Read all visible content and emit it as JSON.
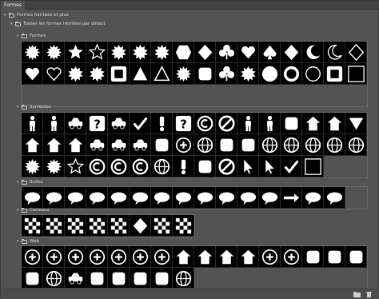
{
  "panel": {
    "tab_label": "Formes"
  },
  "tree": {
    "root_label": "Formes héritées et plus",
    "default_label": "Toutes les formes héritées par défaut",
    "groups": [
      {
        "label": "Formes",
        "icons": [
          "star-burst",
          "sun-burst",
          "star5",
          "star5-outline",
          "gear-seal",
          "seal",
          "badge-seal",
          "hexagon",
          "diamond-frame",
          "clover",
          "heart",
          "spade",
          "diamond",
          "crescent",
          "crescent-outline",
          "diamond-outline",
          "heart-solid",
          "heart-outline",
          "flower-seal",
          "square-seal",
          "square-frame",
          "triangle",
          "triangle-outline",
          "burst-seal",
          "blob",
          "flower",
          "cog-flower",
          "circle",
          "circle-frame",
          "circle-outline",
          "square-frame-thick",
          "square"
        ]
      },
      {
        "label": "Symboles",
        "icons": [
          "man",
          "woman",
          "airplane",
          "help-box",
          "phone",
          "checkmark",
          "exclamation",
          "question",
          "registered-plus",
          "x-mark",
          "pedestrian",
          "family",
          "wheelchair",
          "stop-sign",
          "house-arrow",
          "triangle-down",
          "shield",
          "crest",
          "shield-plain",
          "car-side",
          "car-front",
          "bicycle",
          "recycle",
          "recycle-circle",
          "yin-yang",
          "female",
          "male",
          "target",
          "radiation",
          "atom",
          "globe",
          "crosshair",
          "burst-small",
          "burst-lines",
          "star-outline-small",
          "copyright",
          "registered",
          "trademark",
          "spiral",
          "info",
          "fire",
          "no-sign",
          "cursor",
          "cursor-outline",
          "checkbox",
          "square-small"
        ]
      },
      {
        "label": "Bulles",
        "icons": [
          "bubble1",
          "bubble2",
          "bubble3",
          "bubble4",
          "bubble5",
          "bubble6",
          "oval",
          "bubble7",
          "bubble8",
          "bubble9",
          "bubble10",
          "bubble11",
          "arrow-bar",
          "cloud-bubble",
          "cloud"
        ]
      },
      {
        "label": "Carreaux",
        "icons": [
          "checker",
          "fence",
          "stripes-diag",
          "lines-diag",
          "x-pattern",
          "diamonds",
          "greek",
          "grid-pattern"
        ]
      },
      {
        "label": "Web",
        "icons": [
          "plus-circle",
          "minus-circle",
          "left-circle",
          "right-circle",
          "up-circle",
          "down-circle",
          "eject-circle",
          "download",
          "mail",
          "mail-open",
          "home",
          "question-circle",
          "no-circle",
          "film",
          "music",
          "music2",
          "search",
          "globe-search",
          "cart",
          "speaker",
          "minus-bar",
          "clock",
          "tools",
          "globe2"
        ]
      }
    ]
  },
  "footer": {
    "icons": [
      "folder-new-icon",
      "trash-icon"
    ]
  },
  "colors": {
    "panel": "#535353",
    "swatch_bg": "#000000",
    "shape": "#ffffff"
  }
}
